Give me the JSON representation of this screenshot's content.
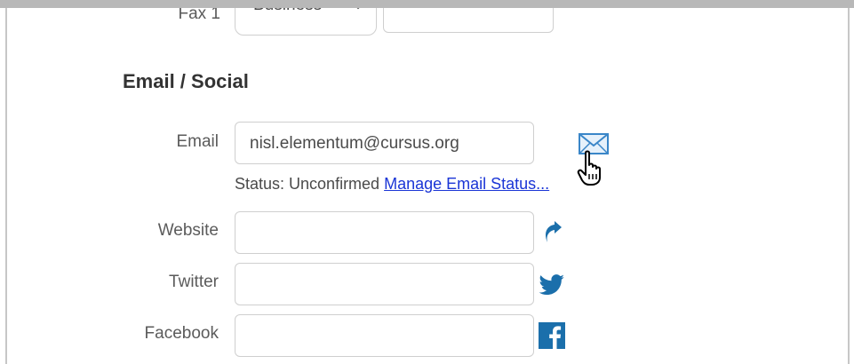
{
  "phone_row": {
    "label": "Fax 1",
    "type_value": "Business",
    "number_value": ""
  },
  "section": {
    "title": "Email / Social"
  },
  "email": {
    "label": "Email",
    "value": "nisl.elementum@cursus.org",
    "status_prefix": "Status: Unconfirmed",
    "status_link": "Manage Email Status..."
  },
  "website": {
    "label": "Website",
    "value": ""
  },
  "twitter": {
    "label": "Twitter",
    "value": ""
  },
  "facebook": {
    "label": "Facebook",
    "value": ""
  },
  "icons": {
    "email": "envelope-icon",
    "website": "arrow-up-right-icon",
    "twitter": "twitter-bird-icon",
    "facebook": "facebook-icon",
    "cursor": "hand-pointer-cursor-icon"
  },
  "colors": {
    "link": "#1a35d6",
    "social_icon": "#1b6fab",
    "envelope": "#3a86c8"
  }
}
